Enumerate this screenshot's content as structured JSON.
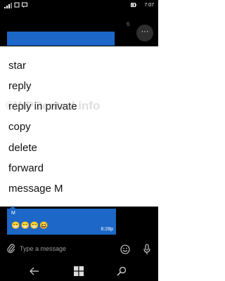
{
  "status_bar": {
    "time": "7:07"
  },
  "header": {
    "count": "6",
    "more_label": "···"
  },
  "menu": {
    "items": [
      "star",
      "reply",
      "reply in private",
      "copy",
      "delete",
      "forward",
      "message M"
    ]
  },
  "watermark": "©WPCentral.info",
  "message": {
    "sender": "M",
    "emojis": "😁😁😁😆",
    "time": "6:28p"
  },
  "compose": {
    "placeholder": "Type a message"
  },
  "icons": {
    "signal": "signal-icon",
    "network": "network-icon",
    "message": "message-icon",
    "battery": "battery-icon",
    "attach": "paperclip-icon",
    "emoji": "smiley-icon",
    "mic": "microphone-icon",
    "back": "back-arrow-icon",
    "windows": "windows-logo-icon",
    "search": "search-icon"
  },
  "colors": {
    "accent": "#1c67c7",
    "dark": "#000000",
    "menu_bg": "#ffffff"
  }
}
